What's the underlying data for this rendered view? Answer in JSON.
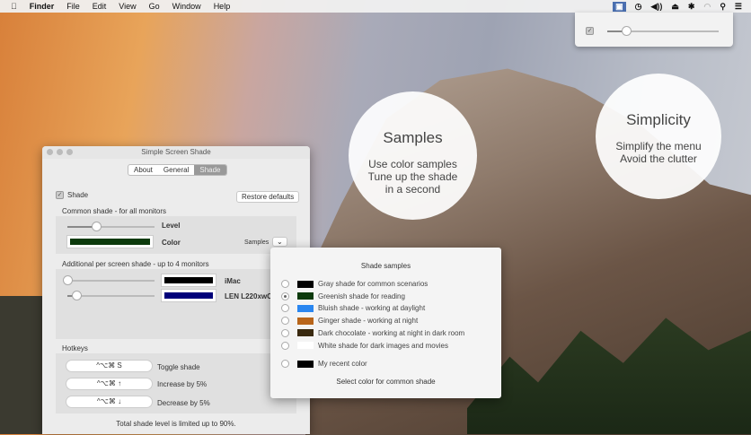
{
  "menubar": {
    "apple": "",
    "app": "Finder",
    "items": [
      "File",
      "Edit",
      "View",
      "Go",
      "Window",
      "Help"
    ]
  },
  "tray": {
    "icons": [
      "shade-icon",
      "time-machine-icon",
      "volume-icon",
      "eject-icon",
      "bluetooth-icon",
      "wifi-icon",
      "search-icon",
      "list-icon"
    ],
    "glyphs": [
      "▣",
      "◷",
      "◀))",
      "⏏",
      "✱",
      "◠",
      "⚲",
      "☰"
    ],
    "slider_level": 0.17
  },
  "circles": [
    {
      "title": "Samples",
      "lines": [
        "Use color samples",
        "Tune up the shade",
        "in a second"
      ]
    },
    {
      "title": "Simplicity",
      "lines": [
        "Simplify the menu",
        "Avoid the clutter"
      ]
    }
  ],
  "window": {
    "title": "Simple Screen Shade",
    "tabs": [
      "About",
      "General",
      "Shade"
    ],
    "active_tab": "Shade",
    "shade_label": "Shade",
    "restore": "Restore defaults",
    "common_header": "Common shade - for all monitors",
    "level_label": "Level",
    "level": 0.33,
    "color_label": "Color",
    "color": "#0c3a0c",
    "samples_label": "Samples",
    "samples_glyph": "⌄",
    "per_screen_header": "Additional per screen shade - up to 4 monitors",
    "monitors": [
      {
        "name": "iMac",
        "level": 0.0,
        "color": "#000000"
      },
      {
        "name": "LEN L220xwC",
        "level": 0.1,
        "color": "#00007a"
      }
    ],
    "hotkeys_header": "Hotkeys",
    "hotkeys": [
      {
        "keys": "^⌥⌘ S",
        "action": "Toggle shade"
      },
      {
        "keys": "^⌥⌘ ↑",
        "action": "Increase by 5%"
      },
      {
        "keys": "^⌥⌘ ↓",
        "action": "Decrease by 5%"
      }
    ],
    "footer": "Total shade level is limited up to 90%."
  },
  "samples": {
    "title": "Shade samples",
    "items": [
      {
        "label": "Gray shade for common scenarios",
        "color": "#000000",
        "selected": false
      },
      {
        "label": "Greenish shade for reading",
        "color": "#0c3a0c",
        "selected": true
      },
      {
        "label": "Bluish shade - working at daylight",
        "color": "#2a86f0",
        "selected": false
      },
      {
        "label": "Ginger shade - working at night",
        "color": "#b8651a",
        "selected": false
      },
      {
        "label": "Dark chocolate - working at night in dark room",
        "color": "#3a2a10",
        "selected": false
      },
      {
        "label": "White shade for dark images and movies",
        "color": "#ffffff",
        "selected": false
      }
    ],
    "recent": {
      "label": "My recent color",
      "color": "#000000"
    },
    "footer": "Select color for common shade"
  }
}
